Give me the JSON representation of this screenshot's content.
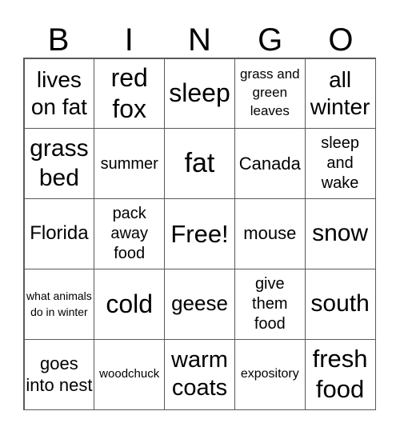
{
  "header": {
    "letters": [
      "B",
      "I",
      "N",
      "G",
      "O"
    ]
  },
  "cells": [
    "lives on fat",
    "red fox",
    "sleep",
    "grass and green leaves",
    "all winter",
    "grass bed",
    "summer",
    "fat",
    "Canada",
    "sleep and wake",
    "Florida",
    "pack away food",
    "Free!",
    "mouse",
    "snow",
    "what animals do in winter",
    "cold",
    "geese",
    "give them food",
    "south",
    "goes into nest",
    "woodchuck",
    "warm coats",
    "expository",
    "fresh food"
  ]
}
